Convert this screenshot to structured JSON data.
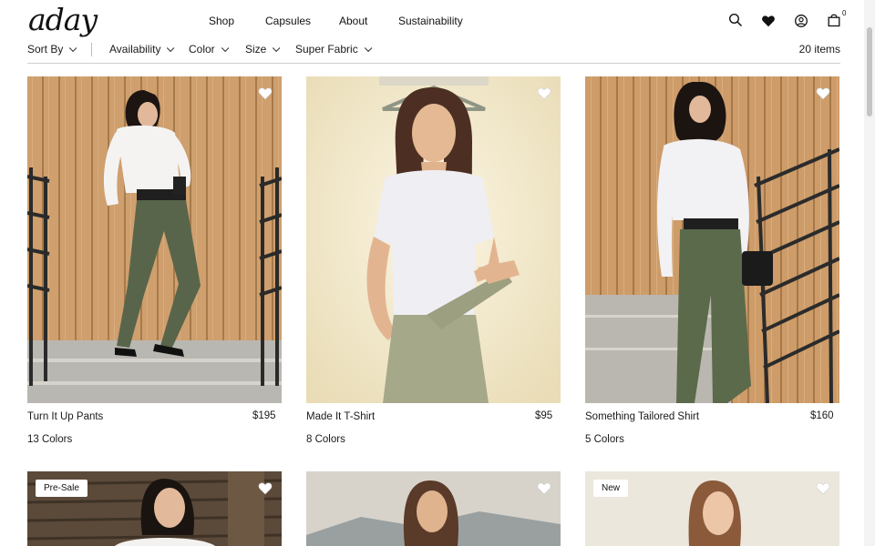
{
  "brand": {
    "logo": "aday"
  },
  "nav": [
    "Shop",
    "Capsules",
    "About",
    "Sustainability"
  ],
  "header_icons": [
    "search-icon",
    "heart-icon",
    "account-icon",
    "bag-icon"
  ],
  "cart": {
    "count": "0"
  },
  "filters": {
    "sort_label": "Sort By",
    "items": [
      "Availability",
      "Color",
      "Size",
      "Super Fabric"
    ],
    "item_count": "20 items"
  },
  "products": [
    {
      "name": "Turn It Up Pants",
      "price": "$195",
      "colors": "13 Colors"
    },
    {
      "name": "Made It T-Shirt",
      "price": "$95",
      "colors": "8 Colors"
    },
    {
      "name": "Something Tailored Shirt",
      "price": "$160",
      "colors": "5 Colors"
    }
  ],
  "row2": [
    {
      "badge": "Pre-Sale"
    },
    {
      "badge": ""
    },
    {
      "badge": "New"
    }
  ],
  "colors": {
    "wood": "#c79a66",
    "olive": "#5d6a4b",
    "cream": "#f2ecd9",
    "sage": "#a7a88e"
  }
}
